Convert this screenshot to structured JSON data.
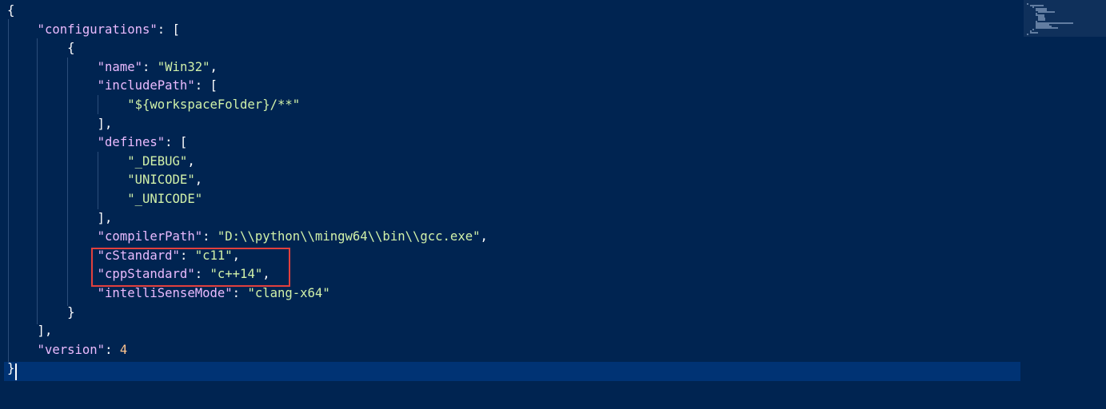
{
  "editor": {
    "language": "json",
    "lines": [
      [
        {
          "t": "{",
          "c": "punct"
        }
      ],
      [
        {
          "t": "    \"configurations\"",
          "c": "key"
        },
        {
          "t": ": [",
          "c": "punct"
        }
      ],
      [
        {
          "t": "        {",
          "c": "punct"
        }
      ],
      [
        {
          "t": "            \"name\"",
          "c": "key"
        },
        {
          "t": ": ",
          "c": "punct"
        },
        {
          "t": "\"Win32\"",
          "c": "str"
        },
        {
          "t": ",",
          "c": "punct"
        }
      ],
      [
        {
          "t": "            \"includePath\"",
          "c": "key"
        },
        {
          "t": ": [",
          "c": "punct"
        }
      ],
      [
        {
          "t": "                \"${workspaceFolder}/**\"",
          "c": "str"
        }
      ],
      [
        {
          "t": "            ],",
          "c": "punct"
        }
      ],
      [
        {
          "t": "            \"defines\"",
          "c": "key"
        },
        {
          "t": ": [",
          "c": "punct"
        }
      ],
      [
        {
          "t": "                \"_DEBUG\"",
          "c": "str"
        },
        {
          "t": ",",
          "c": "punct"
        }
      ],
      [
        {
          "t": "                \"UNICODE\"",
          "c": "str"
        },
        {
          "t": ",",
          "c": "punct"
        }
      ],
      [
        {
          "t": "                \"_UNICODE\"",
          "c": "str"
        }
      ],
      [
        {
          "t": "            ],",
          "c": "punct"
        }
      ],
      [
        {
          "t": "            \"compilerPath\"",
          "c": "key"
        },
        {
          "t": ": ",
          "c": "punct"
        },
        {
          "t": "\"D:\\\\python\\\\mingw64\\\\bin\\\\gcc.exe\"",
          "c": "str"
        },
        {
          "t": ",",
          "c": "punct"
        }
      ],
      [
        {
          "t": "            \"cStandard\"",
          "c": "key"
        },
        {
          "t": ": ",
          "c": "punct"
        },
        {
          "t": "\"c11\"",
          "c": "str"
        },
        {
          "t": ",",
          "c": "punct"
        }
      ],
      [
        {
          "t": "            \"cppStandard\"",
          "c": "key"
        },
        {
          "t": ": ",
          "c": "punct"
        },
        {
          "t": "\"c++14\"",
          "c": "str"
        },
        {
          "t": ",",
          "c": "punct"
        }
      ],
      [
        {
          "t": "            \"intelliSenseMode\"",
          "c": "key"
        },
        {
          "t": ": ",
          "c": "punct"
        },
        {
          "t": "\"clang-x64\"",
          "c": "str"
        }
      ],
      [
        {
          "t": "        }",
          "c": "punct"
        }
      ],
      [
        {
          "t": "    ],",
          "c": "punct"
        }
      ],
      [
        {
          "t": "    \"version\"",
          "c": "key"
        },
        {
          "t": ": ",
          "c": "punct"
        },
        {
          "t": "4",
          "c": "num"
        }
      ],
      [
        {
          "t": "}",
          "c": "punct"
        }
      ]
    ],
    "highlighted_keys": [
      "cStandard",
      "cppStandard"
    ],
    "current_line": 20
  },
  "theme": {
    "background": "#002451",
    "current_line_background": "#003374",
    "key_color": "#ebbbff",
    "string_color": "#d1f1a9",
    "number_color": "#ffc58f",
    "punctuation_color": "#ffffff",
    "annotation_box_color": "#e2403d"
  }
}
